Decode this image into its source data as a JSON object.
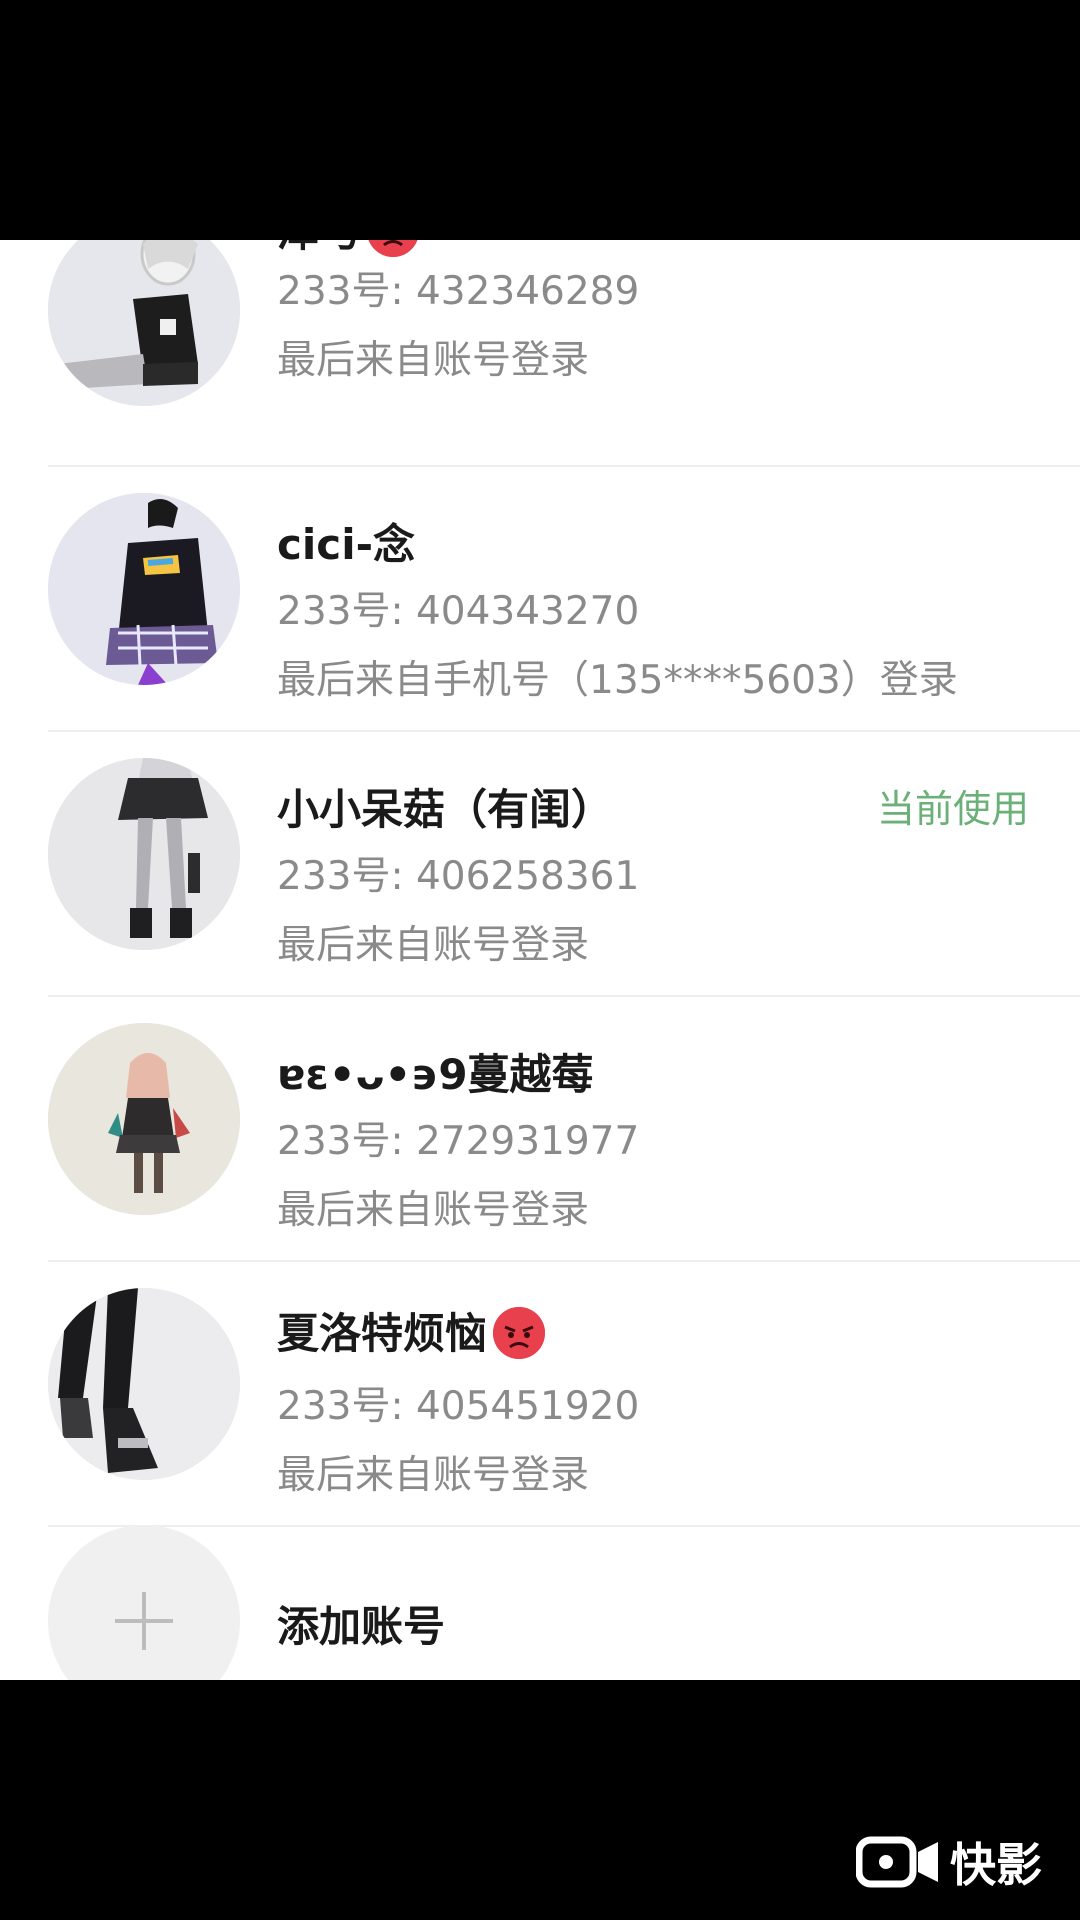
{
  "accounts": [
    {
      "name": "泽与",
      "has_angry_emoji": true,
      "uid": "233号: 432346289",
      "login": "最后来自账号登录",
      "current": ""
    },
    {
      "name": "cici-念",
      "has_angry_emoji": false,
      "uid": "233号: 404343270",
      "login": "最后来自手机号（135****5603）登录",
      "current": ""
    },
    {
      "name": "小小呆菇（有闺）",
      "has_angry_emoji": false,
      "uid": "233号: 406258361",
      "login": "最后来自账号登录",
      "current": "当前使用"
    },
    {
      "name": "ɐɛ•ᴗ•϶9蔓越莓",
      "has_angry_emoji": false,
      "uid": "233号: 272931977",
      "login": "最后来自账号登录",
      "current": ""
    },
    {
      "name": "夏洛特烦恼",
      "has_angry_emoji": true,
      "uid": "233号: 405451920",
      "login": "最后来自账号登录",
      "current": ""
    }
  ],
  "add_account": {
    "label": "添加账号",
    "icon": "plus-icon"
  },
  "watermark": {
    "text": "快影",
    "icon": "kuaiying-logo-icon"
  },
  "colors": {
    "current_label": "#6bb077",
    "angry_emoji": "#e9404d",
    "secondary_text": "#8a8a8a"
  }
}
